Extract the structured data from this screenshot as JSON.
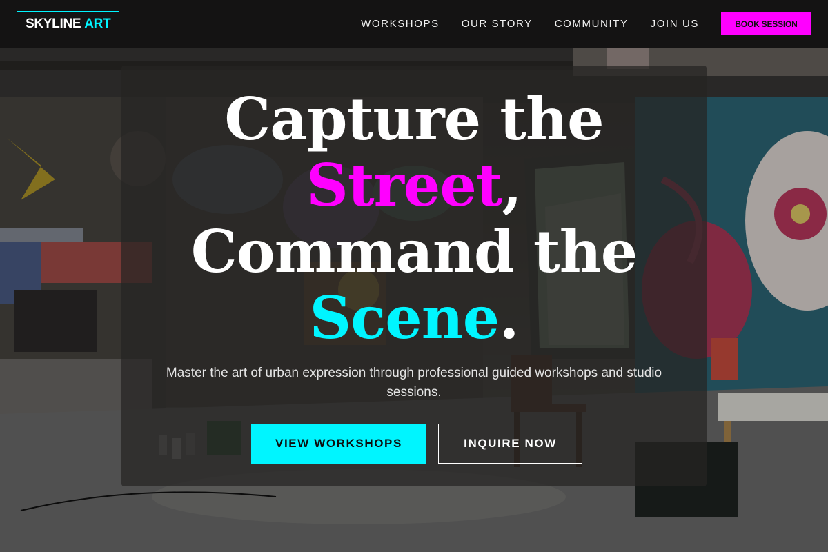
{
  "brand": {
    "name": "SKYLINE",
    "accent": "ART"
  },
  "nav": {
    "links": [
      "WORKSHOPS",
      "OUR STORY",
      "COMMUNITY",
      "JOIN US"
    ],
    "cta": "BOOK SESSION"
  },
  "hero": {
    "headline": {
      "line1": "Capture the",
      "street": "Street",
      "comma": ",",
      "line3": "Command the",
      "scene": "Scene",
      "period": "."
    },
    "subcopy": "Master the art of urban expression through professional guided workshops and studio sessions.",
    "primary_cta": "VIEW WORKSHOPS",
    "secondary_cta": "INQUIRE NOW"
  },
  "colors": {
    "accent_cyan": "#00f5ff",
    "accent_magenta": "#ff00ff",
    "nav_bg": "#121212"
  }
}
